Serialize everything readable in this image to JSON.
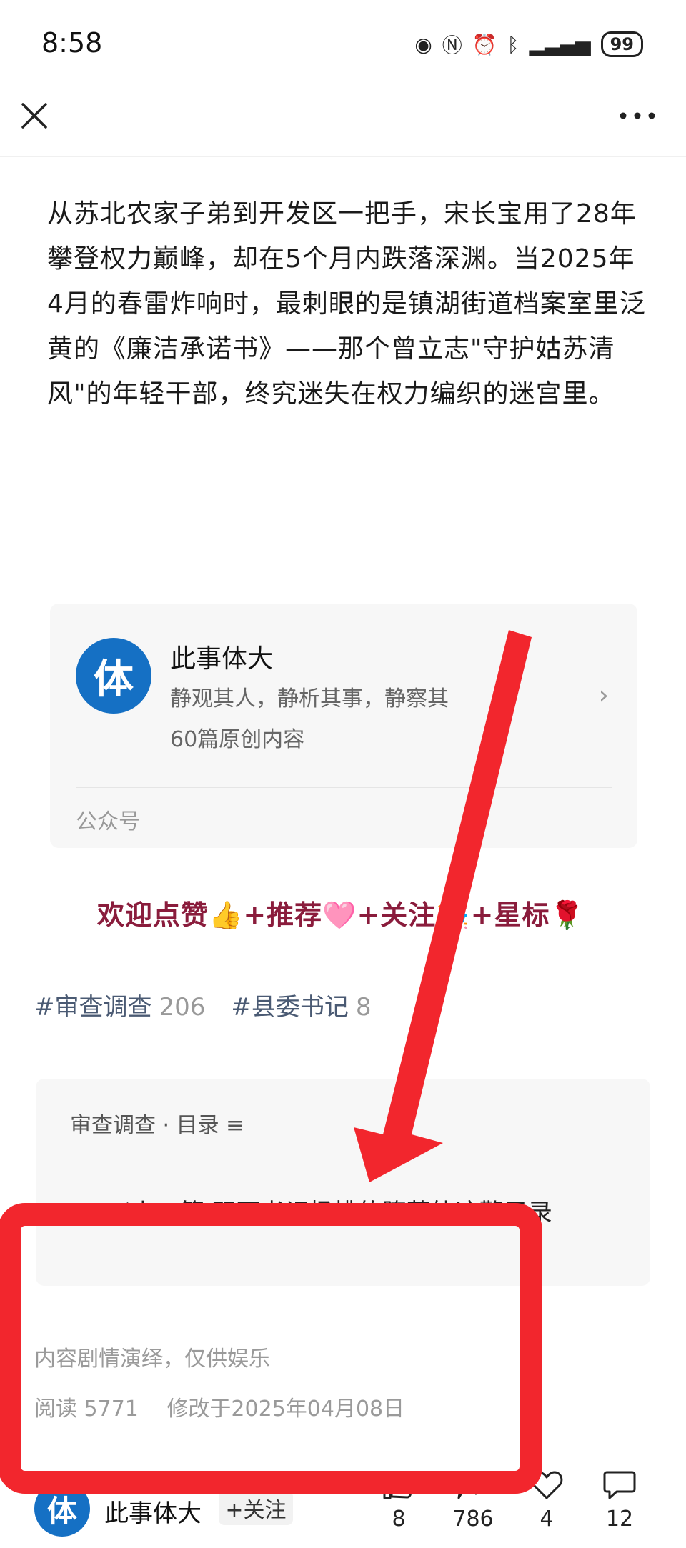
{
  "status_bar": {
    "time": "8:58",
    "battery": "99"
  },
  "article": {
    "body": "从苏北农家子弟到开发区一把手，宋长宝用了28年攀登权力巅峰，却在5个月内跌落深渊。当2025年4月的春雷炸响时，最刺眼的是镇湖街道档案室里泛黄的《廉洁承诺书》——那个曾立志\"守护姑苏清风\"的年轻干部，终究迷失在权力编织的迷宫里。"
  },
  "account_card": {
    "avatar_char": "体",
    "name": "此事体大",
    "description": "静观其人，静析其事，静察其",
    "original_count": "60篇原创内容",
    "type": "公众号"
  },
  "promo": "欢迎点赞👍+推荐🩷+关注🎉+星标🌹",
  "tags": [
    {
      "name": "审查调查",
      "count": "206"
    },
    {
      "name": "县委书记",
      "count": "8"
    }
  ],
  "series": {
    "title": "审查调查 · 目录 ≡",
    "prev": "＜上一篇  双面书记杨桃的堕落轨迹警示录"
  },
  "disclaimer": "内容剧情演绎，仅供娱乐",
  "meta": {
    "reads": "阅读 5771",
    "modified": "修改于2025年04月08日"
  },
  "bottom_bar": {
    "avatar_char": "体",
    "author": "此事体大",
    "follow": "+关注",
    "likes": "8",
    "shares": "786",
    "favorites": "4",
    "comments": "12"
  },
  "colors": {
    "accent_red": "#f2262d",
    "avatar_blue": "#1570c4",
    "promo": "#8a1c3c"
  }
}
